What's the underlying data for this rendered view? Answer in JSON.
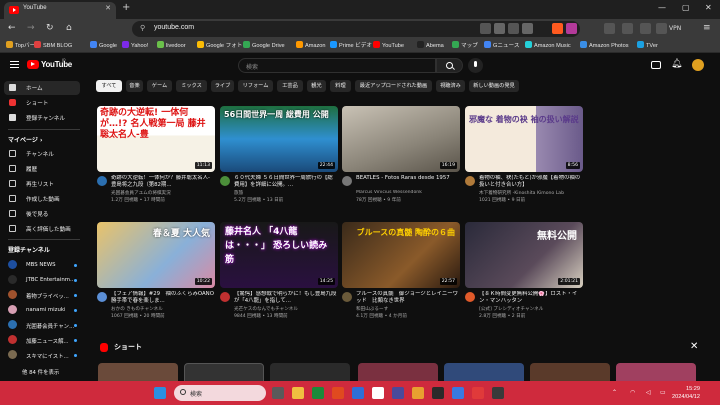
{
  "browser": {
    "tab_title": "YouTube",
    "url": "youtube.com",
    "vpn_label": "VPN",
    "bookmarks": [
      {
        "label": "Topバー",
        "color": "#e0a020"
      },
      {
        "label": "SBM BLOG",
        "color": "#e04040"
      },
      {
        "label": "Google",
        "color": "#4285f4"
      },
      {
        "label": "Yahoo!",
        "color": "#7d2ae8"
      },
      {
        "label": "livedoor",
        "color": "#6ac04a"
      },
      {
        "label": "Google フォト",
        "color": "#fbbc05"
      },
      {
        "label": "Google Drive",
        "color": "#34a853"
      },
      {
        "label": "Amazon",
        "color": "#ff9900"
      },
      {
        "label": "Prime ビデオ",
        "color": "#1a98ff"
      },
      {
        "label": "YouTube",
        "color": "#ff0000"
      },
      {
        "label": "Abema",
        "color": "#222222"
      },
      {
        "label": "マップ",
        "color": "#34a853"
      },
      {
        "label": "Gニュース",
        "color": "#4285f4"
      },
      {
        "label": "Amazon Music",
        "color": "#25d1da"
      },
      {
        "label": "Amazon Photos",
        "color": "#3a8ee6"
      },
      {
        "label": "TVer",
        "color": "#1ba1e2"
      }
    ]
  },
  "youtube": {
    "logo_text": "YouTube",
    "logo_region": "JP",
    "search_placeholder": "検索",
    "sidebar": {
      "main": [
        {
          "label": "ホーム",
          "active": true
        },
        {
          "label": "ショート",
          "active": false
        },
        {
          "label": "登録チャンネル",
          "active": false
        }
      ],
      "my_header": "マイページ ›",
      "mine": [
        {
          "label": "チャンネル"
        },
        {
          "label": "履歴"
        },
        {
          "label": "再生リスト"
        },
        {
          "label": "作成した動画"
        },
        {
          "label": "後で見る"
        },
        {
          "label": "高く評価した動画"
        }
      ],
      "subs_header": "登録チャンネル",
      "subs": [
        {
          "label": "MBS NEWS",
          "color": "#1d4fa0"
        },
        {
          "label": "JTBC Entertainm...",
          "color": "#2a2a2a"
        },
        {
          "label": "着物プライベッ...",
          "color": "#a0522d"
        },
        {
          "label": "nanami mizuki",
          "color": "#d79fb3"
        },
        {
          "label": "光囲碁会員チャン...",
          "color": "#2b6fb0"
        },
        {
          "label": "加藤ニュース解...",
          "color": "#c03030"
        },
        {
          "label": "スキマにイスト...",
          "color": "#7a6a50"
        }
      ],
      "more": "他 84 件を表示"
    },
    "chips": [
      "すべて",
      "音楽",
      "ゲーム",
      "ミックス",
      "ライブ",
      "リフォーム",
      "工芸品",
      "観光",
      "料理",
      "最近アップロードされた動画",
      "視聴済み",
      "新しい動画の発見"
    ],
    "videos": [
      {
        "title": "奇跡の大逆転！一体何が？藤井聡太名人-豊島将之九段（第82期...",
        "channel": "光囲碁会員アユムの将棋実況",
        "meta": "1.2万 回視聴 • 17 時間前",
        "duration": "11:13",
        "thumb_text": "奇跡の大逆転! 一体何が…!? 名人戦第一局 藤井聡太名人-豊",
        "avatar": "#2b6fb0"
      },
      {
        "title": "６０代夫婦 ５６日間世界一周旅行の【総費用】を詳細に公開。...",
        "channel": "旅旅",
        "meta": "5.2万 回視聴 • 13 日前",
        "duration": "22:44",
        "thumb_text": "56日間世界一周 総費用 公開",
        "avatar": "#4c8f3a"
      },
      {
        "title": "BEATLES - Fotos Raras desde 1957",
        "channel": "Marcus Vinicius Wessendonk",
        "meta": "78万 回視聴 • 9 年前",
        "duration": "16:19",
        "thumb_text": "",
        "avatar": "#777777"
      },
      {
        "title": "着物の袖、袂(たもと)が邪魔【着物の袖の扱いと付き合い方】",
        "channel": "木下着物研究所 -Kinoshita Kimono Lab",
        "meta": "1021 回視聴 • 9 日前",
        "duration": "8:56",
        "thumb_text": "邪魔な 着物の袂 袖の扱い解説",
        "avatar": "#b07a3a"
      },
      {
        "title": "【フェア情報】#29　袖のふくらみOANO勝手帯で春を楽しま...",
        "channel": "おかの きものチャンネル",
        "meta": "1067 回視聴 • 20 時間前",
        "duration": "10:22",
        "thumb_text": "春＆夏 大人気",
        "avatar": "#5b8fd6"
      },
      {
        "title": "【驚愕】感想戦で明らかに！もし豊島九段が「4八龍」を指して...",
        "channel": "光芒ケスのなんでもチャンネル",
        "meta": "9844 回視聴 • 13 時間前",
        "duration": "14:25",
        "thumb_text": "藤井名人 「4八龍は・・・」 恐ろしい読み筋",
        "avatar": "#c03030"
      },
      {
        "title": "ブルースの真髄　御ジョージとレイニーウッド　比類なき世界",
        "channel": "和田山ぶるーす",
        "meta": "4.1万 回視聴 • 4 か月前",
        "duration": "22:57",
        "thumb_text": "ブルースの真髄 陶酔の６曲",
        "avatar": "#6a5a3a"
      },
      {
        "title": "【８Ｋ時間変更無料公開🌸】ロスト・イン・マンハッタン",
        "channel": "[公式] プレシディオチャンネル",
        "meta": "2.8万 回視聴 • 2 日前",
        "duration": "2:01:21",
        "thumb_text": "無料公開",
        "avatar": "#e05a2a"
      }
    ],
    "shorts_label": "ショート"
  },
  "taskbar": {
    "search_placeholder": "検索",
    "time": "15:29",
    "date": "2024/04/12"
  }
}
